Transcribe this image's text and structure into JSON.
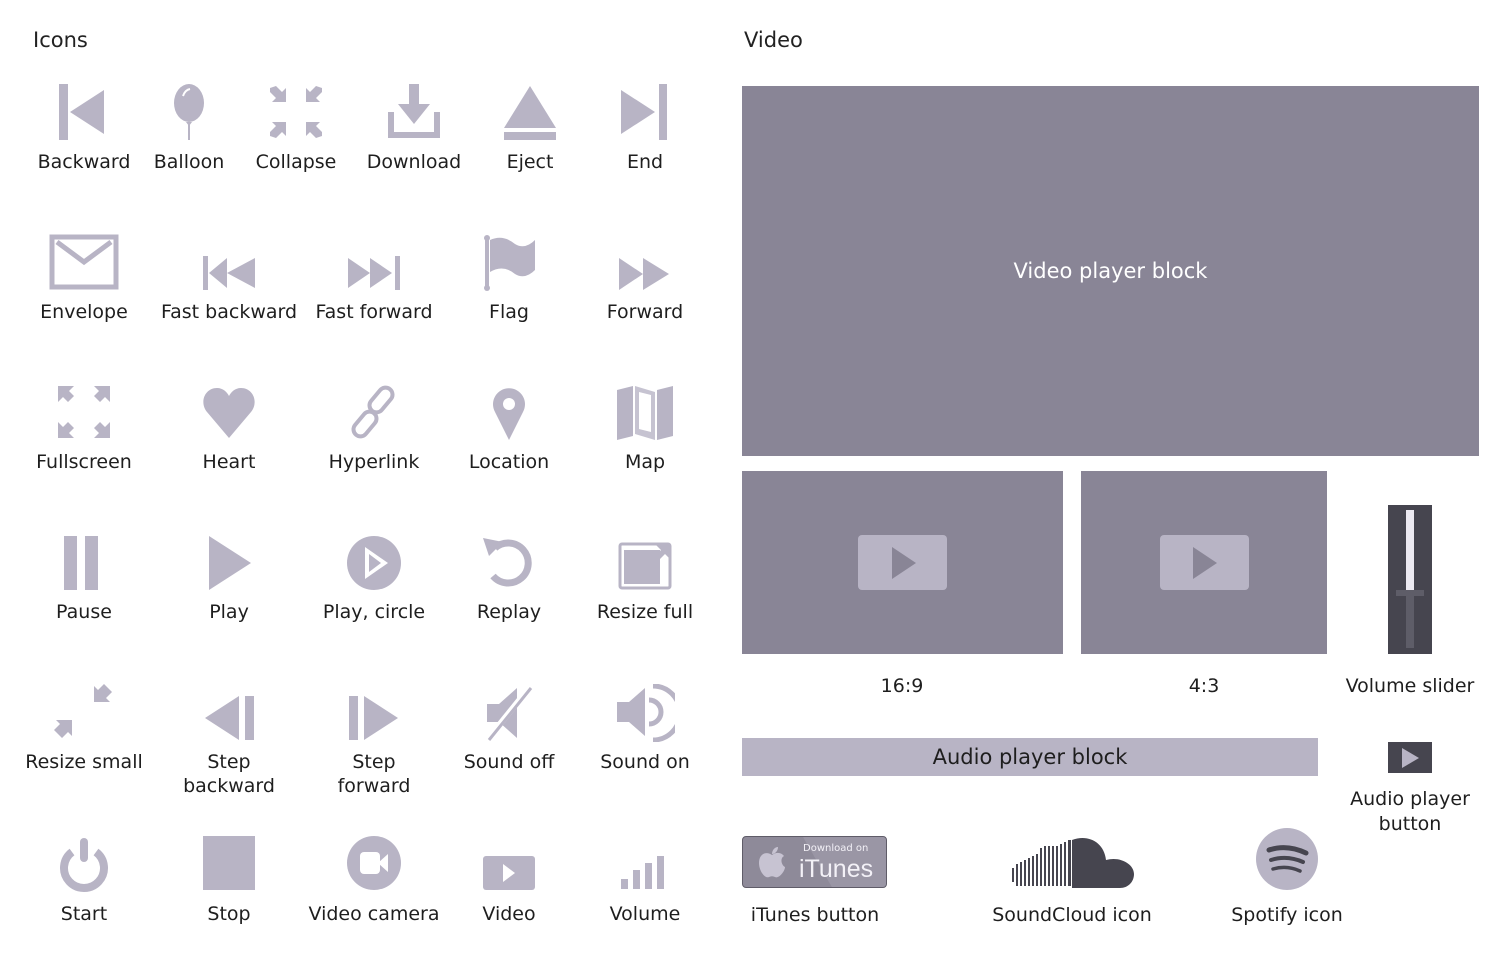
{
  "sections": {
    "icons_title": "Icons",
    "video_title": "Video"
  },
  "icons": [
    {
      "label": "Backward",
      "icon": "backward-icon"
    },
    {
      "label": "Balloon",
      "icon": "balloon-icon"
    },
    {
      "label": "Collapse",
      "icon": "collapse-icon"
    },
    {
      "label": "Download",
      "icon": "download-icon"
    },
    {
      "label": "Eject",
      "icon": "eject-icon"
    },
    {
      "label": "End",
      "icon": "end-icon"
    },
    {
      "label": "Envelope",
      "icon": "envelope-icon"
    },
    {
      "label": "Fast backward",
      "icon": "fast-backward-icon"
    },
    {
      "label": "Fast forward",
      "icon": "fast-forward-icon"
    },
    {
      "label": "Flag",
      "icon": "flag-icon"
    },
    {
      "label": "Forward",
      "icon": "forward-icon"
    },
    {
      "label": "Fullscreen",
      "icon": "fullscreen-icon"
    },
    {
      "label": "Heart",
      "icon": "heart-icon"
    },
    {
      "label": "Hyperlink",
      "icon": "hyperlink-icon"
    },
    {
      "label": "Location",
      "icon": "location-icon"
    },
    {
      "label": "Map",
      "icon": "map-icon"
    },
    {
      "label": "Pause",
      "icon": "pause-icon"
    },
    {
      "label": "Play",
      "icon": "play-icon"
    },
    {
      "label": "Play, circle",
      "icon": "play-circle-icon"
    },
    {
      "label": "Replay",
      "icon": "replay-icon"
    },
    {
      "label": "Resize full",
      "icon": "resize-full-icon"
    },
    {
      "label": "Resize small",
      "icon": "resize-small-icon"
    },
    {
      "label": "Step\nbackward",
      "icon": "step-backward-icon"
    },
    {
      "label": "Step\nforward",
      "icon": "step-forward-icon"
    },
    {
      "label": "Sound off",
      "icon": "sound-off-icon"
    },
    {
      "label": "Sound on",
      "icon": "sound-on-icon"
    },
    {
      "label": "Start",
      "icon": "power-icon"
    },
    {
      "label": "Stop",
      "icon": "stop-icon"
    },
    {
      "label": "Video camera",
      "icon": "video-camera-icon"
    },
    {
      "label": "Video",
      "icon": "video-icon"
    },
    {
      "label": "Volume",
      "icon": "volume-bars-icon"
    }
  ],
  "video": {
    "main_block_label": "Video player block",
    "thumb_16_9_label": "16:9",
    "thumb_4_3_label": "4:3",
    "volume_slider_label": "Volume slider",
    "volume_level": 0.4,
    "audio_block_label": "Audio player block",
    "audio_button_label": "Audio player\nbutton",
    "itunes": {
      "small_text": "Download on",
      "big_text": "iTunes",
      "label": "iTunes button"
    },
    "soundcloud_label": "SoundCloud icon",
    "spotify_label": "Spotify icon"
  },
  "colors": {
    "icon": "#b8b4c5",
    "video_block": "#898596",
    "dark": "#46454f"
  }
}
